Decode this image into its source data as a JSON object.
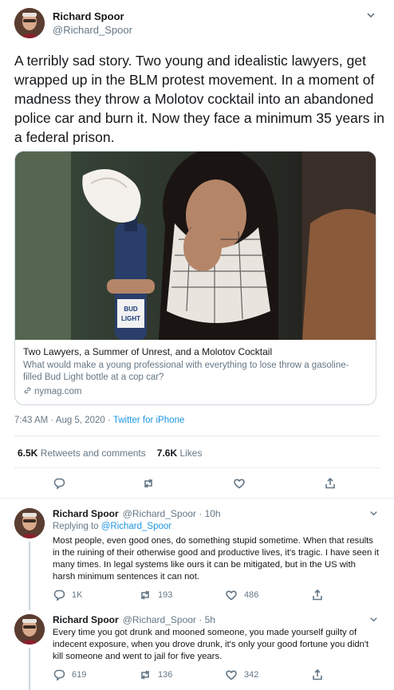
{
  "main_tweet": {
    "author_name": "Richard Spoor",
    "author_handle": "@Richard_Spoor",
    "text": "A terribly sad story. Two young and idealistic lawyers, get wrapped up in the BLM protest movement. In a moment of madness they throw a Molotov cocktail into an abandoned police car and burn it. Now they face a minimum 35 years in a federal prison.",
    "card": {
      "title": "Two Lawyers, a Summer of Unrest, and a Molotov Cocktail",
      "description": "What would make a young professional with everything to lose throw a gasoline-filled Bud Light bottle at a cop car?",
      "domain": "nymag.com",
      "bottle_label": "BUD LIGHT"
    },
    "timestamp": "7:43 AM · Aug 5, 2020 · ",
    "source": "Twitter for iPhone",
    "retweets_count": "6.5K",
    "retweets_label": "Retweets and comments",
    "likes_count": "7.6K",
    "likes_label": "Likes"
  },
  "replies": [
    {
      "author_name": "Richard Spoor",
      "author_handle": "@Richard_Spoor · 10h",
      "replying_prefix": "Replying to ",
      "replying_to": "@Richard_Spoor",
      "text": "Most people, even good ones, do something stupid sometime. When that results in the ruining of their otherwise good and productive lives, it's tragic. I have seen it many times. In legal systems like ours it can be mitigated, but in the US with harsh minimum sentences it can not.",
      "reply_count": "1K",
      "retweet_count": "193",
      "like_count": "486"
    },
    {
      "author_name": "Richard Spoor",
      "author_handle": "@Richard_Spoor · 5h",
      "text": "Every time you got drunk and mooned someone, you made yourself guilty of indecent exposure, when you drove drunk, it's only your good fortune you didn't kill someone and went to jail for five years.",
      "reply_count": "619",
      "retweet_count": "136",
      "like_count": "342"
    }
  ],
  "colors": {
    "link": "#1b95e0",
    "secondary_text": "#657786",
    "border": "#e6ecf0"
  },
  "icons": {
    "more": "chevron-down-icon",
    "reply": "comment-icon",
    "retweet": "retweet-icon",
    "like": "heart-icon",
    "share": "share-icon",
    "domain": "link-icon"
  }
}
